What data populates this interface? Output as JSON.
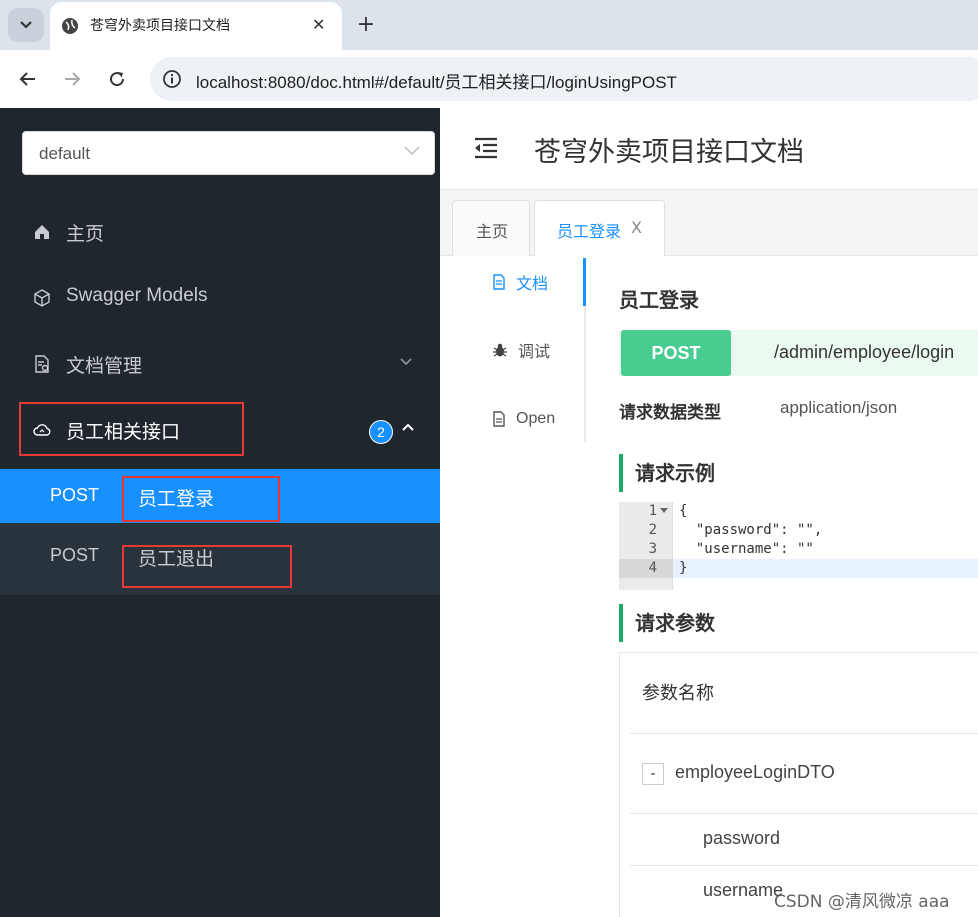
{
  "browser": {
    "tab_title": "苍穹外卖项目接口文档",
    "url": "localhost:8080/doc.html#/default/员工相关接口/loginUsingPOST",
    "new_tab": "+",
    "close_tab": "✕"
  },
  "sidebar": {
    "group_select_value": "default",
    "items": [
      {
        "label": "主页",
        "icon": "home-icon"
      },
      {
        "label": "Swagger Models",
        "icon": "cube-icon"
      },
      {
        "label": "文档管理",
        "icon": "doc-settings-icon"
      },
      {
        "label": "员工相关接口",
        "icon": "cloud-icon",
        "badge": "2",
        "expanded": true
      }
    ],
    "apis": [
      {
        "method": "POST",
        "name": "员工登录",
        "active": true
      },
      {
        "method": "POST",
        "name": "员工退出",
        "active": false
      }
    ]
  },
  "header": {
    "title": "苍穹外卖项目接口文档"
  },
  "tabs": [
    {
      "label": "主页"
    },
    {
      "label": "员工登录",
      "close": "X"
    }
  ],
  "subnav": [
    {
      "label": "文档",
      "icon": "document-icon"
    },
    {
      "label": "调试",
      "icon": "bug-icon"
    },
    {
      "label": "Open",
      "icon": "file-icon"
    }
  ],
  "api": {
    "title": "员工登录",
    "method": "POST",
    "path": "/admin/employee/login",
    "content_type_label": "请求数据类型",
    "content_type": "application/json"
  },
  "example": {
    "title": "请求示例",
    "line_numbers": [
      "1",
      "2",
      "3",
      "4"
    ],
    "lines": [
      "{",
      "  \"password\": \"\",",
      "  \"username\": \"\"",
      "}"
    ]
  },
  "params": {
    "title": "请求参数",
    "header": "参数名称",
    "rows": [
      {
        "name": "employeeLoginDTO",
        "toggle": "-"
      },
      {
        "name": "password"
      },
      {
        "name": "username"
      }
    ]
  },
  "watermark": "CSDN @清风微凉 aaa",
  "colors": {
    "sidebar_bg": "#1f262d",
    "active_blue": "#1890ff",
    "post_green": "#49cc90",
    "highlight_red": "#e53935"
  }
}
